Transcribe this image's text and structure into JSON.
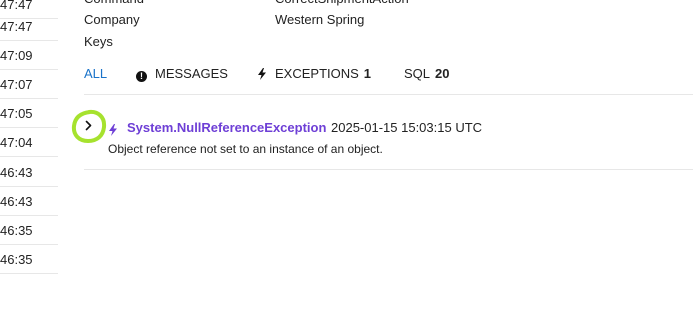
{
  "left_list": {
    "times": [
      "47:47",
      "47:09",
      "47:07",
      "47:05",
      "47:04",
      "46:43",
      "46:43",
      "46:35",
      "46:35"
    ]
  },
  "meta": {
    "rows": [
      {
        "key": "Command",
        "value": "CorrectShipmentAction"
      },
      {
        "key": "Company",
        "value": "Western Spring"
      },
      {
        "key": "Keys",
        "value": ""
      }
    ]
  },
  "tabs": {
    "all": "ALL",
    "messages": "MESSAGES",
    "exceptions": "EXCEPTIONS",
    "exceptions_count": "1",
    "sql": "SQL",
    "sql_count": "20"
  },
  "exception": {
    "type": "System.NullReferenceException",
    "timestamp": "2025-01-15 15:03:15 UTC",
    "message": "Object reference not set to an instance of an object."
  },
  "colors": {
    "active_tab": "#1a73c9",
    "exception_name": "#6e3fd6",
    "highlight_circle": "#a6e22e"
  }
}
